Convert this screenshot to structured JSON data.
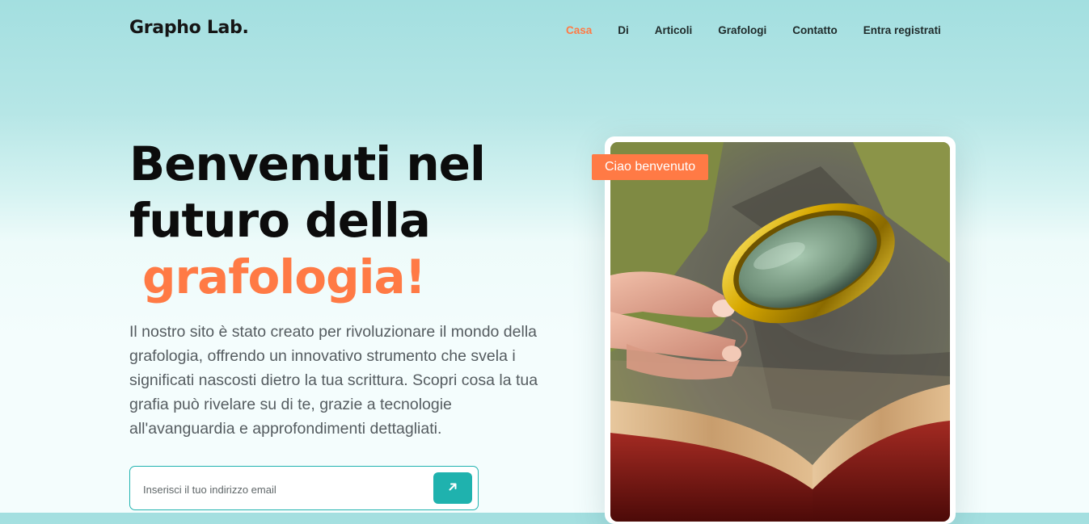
{
  "brand": {
    "name": "Grapho Lab."
  },
  "nav": {
    "items": [
      {
        "label": "Casa",
        "active": true
      },
      {
        "label": "Di"
      },
      {
        "label": "Articoli"
      },
      {
        "label": "Grafologi"
      },
      {
        "label": "Contatto"
      },
      {
        "label": "Entra registrati"
      }
    ]
  },
  "hero": {
    "title_line1": "Benvenuti nel",
    "title_line2": "futuro della",
    "title_accent": "grafologia!",
    "description": "Il nostro sito è stato creato per rivoluzionare il mondo della grafologia, offrendo un innovativo strumento che svela i significati nascosti dietro la tua scrittura. Scopri cosa la tua grafia può rivelare su di te, grazie a tecnologie all'avanguardia e approfondimenti dettagliati.",
    "email_placeholder": "Inserisci il tuo indirizzo email",
    "email_value": "",
    "submit_icon": "arrow-up-right-icon"
  },
  "image_card": {
    "badge": "Ciao benvenuto",
    "image": "person-holding-magnifying-glass-over-book"
  },
  "colors": {
    "accent": "#ff7a45",
    "teal": "#1fb2ae",
    "text_dark": "#0c0c0c",
    "text_muted": "#555c60"
  }
}
